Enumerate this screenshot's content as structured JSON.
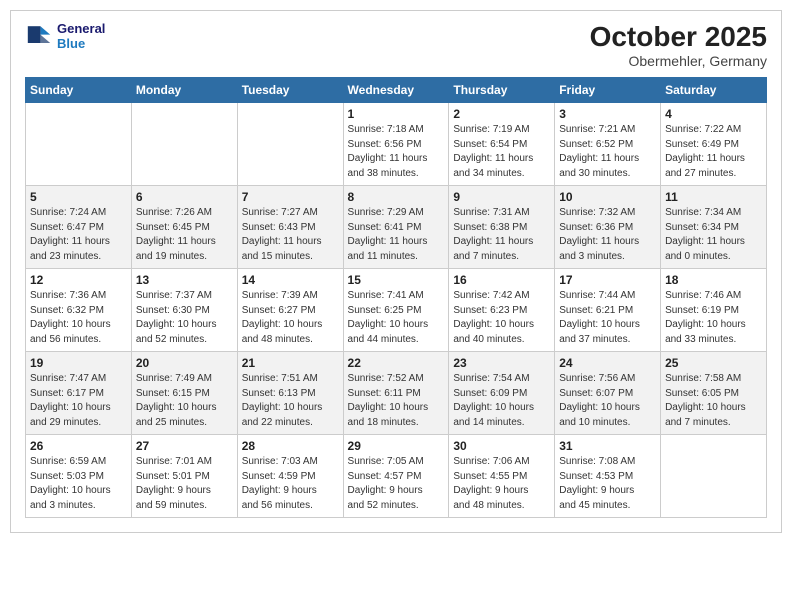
{
  "header": {
    "logo_line1": "General",
    "logo_line2": "Blue",
    "month": "October 2025",
    "location": "Obermehler, Germany"
  },
  "days_of_week": [
    "Sunday",
    "Monday",
    "Tuesday",
    "Wednesday",
    "Thursday",
    "Friday",
    "Saturday"
  ],
  "weeks": [
    [
      {
        "day": "",
        "info": ""
      },
      {
        "day": "",
        "info": ""
      },
      {
        "day": "",
        "info": ""
      },
      {
        "day": "1",
        "info": "Sunrise: 7:18 AM\nSunset: 6:56 PM\nDaylight: 11 hours\nand 38 minutes."
      },
      {
        "day": "2",
        "info": "Sunrise: 7:19 AM\nSunset: 6:54 PM\nDaylight: 11 hours\nand 34 minutes."
      },
      {
        "day": "3",
        "info": "Sunrise: 7:21 AM\nSunset: 6:52 PM\nDaylight: 11 hours\nand 30 minutes."
      },
      {
        "day": "4",
        "info": "Sunrise: 7:22 AM\nSunset: 6:49 PM\nDaylight: 11 hours\nand 27 minutes."
      }
    ],
    [
      {
        "day": "5",
        "info": "Sunrise: 7:24 AM\nSunset: 6:47 PM\nDaylight: 11 hours\nand 23 minutes."
      },
      {
        "day": "6",
        "info": "Sunrise: 7:26 AM\nSunset: 6:45 PM\nDaylight: 11 hours\nand 19 minutes."
      },
      {
        "day": "7",
        "info": "Sunrise: 7:27 AM\nSunset: 6:43 PM\nDaylight: 11 hours\nand 15 minutes."
      },
      {
        "day": "8",
        "info": "Sunrise: 7:29 AM\nSunset: 6:41 PM\nDaylight: 11 hours\nand 11 minutes."
      },
      {
        "day": "9",
        "info": "Sunrise: 7:31 AM\nSunset: 6:38 PM\nDaylight: 11 hours\nand 7 minutes."
      },
      {
        "day": "10",
        "info": "Sunrise: 7:32 AM\nSunset: 6:36 PM\nDaylight: 11 hours\nand 3 minutes."
      },
      {
        "day": "11",
        "info": "Sunrise: 7:34 AM\nSunset: 6:34 PM\nDaylight: 11 hours\nand 0 minutes."
      }
    ],
    [
      {
        "day": "12",
        "info": "Sunrise: 7:36 AM\nSunset: 6:32 PM\nDaylight: 10 hours\nand 56 minutes."
      },
      {
        "day": "13",
        "info": "Sunrise: 7:37 AM\nSunset: 6:30 PM\nDaylight: 10 hours\nand 52 minutes."
      },
      {
        "day": "14",
        "info": "Sunrise: 7:39 AM\nSunset: 6:27 PM\nDaylight: 10 hours\nand 48 minutes."
      },
      {
        "day": "15",
        "info": "Sunrise: 7:41 AM\nSunset: 6:25 PM\nDaylight: 10 hours\nand 44 minutes."
      },
      {
        "day": "16",
        "info": "Sunrise: 7:42 AM\nSunset: 6:23 PM\nDaylight: 10 hours\nand 40 minutes."
      },
      {
        "day": "17",
        "info": "Sunrise: 7:44 AM\nSunset: 6:21 PM\nDaylight: 10 hours\nand 37 minutes."
      },
      {
        "day": "18",
        "info": "Sunrise: 7:46 AM\nSunset: 6:19 PM\nDaylight: 10 hours\nand 33 minutes."
      }
    ],
    [
      {
        "day": "19",
        "info": "Sunrise: 7:47 AM\nSunset: 6:17 PM\nDaylight: 10 hours\nand 29 minutes."
      },
      {
        "day": "20",
        "info": "Sunrise: 7:49 AM\nSunset: 6:15 PM\nDaylight: 10 hours\nand 25 minutes."
      },
      {
        "day": "21",
        "info": "Sunrise: 7:51 AM\nSunset: 6:13 PM\nDaylight: 10 hours\nand 22 minutes."
      },
      {
        "day": "22",
        "info": "Sunrise: 7:52 AM\nSunset: 6:11 PM\nDaylight: 10 hours\nand 18 minutes."
      },
      {
        "day": "23",
        "info": "Sunrise: 7:54 AM\nSunset: 6:09 PM\nDaylight: 10 hours\nand 14 minutes."
      },
      {
        "day": "24",
        "info": "Sunrise: 7:56 AM\nSunset: 6:07 PM\nDaylight: 10 hours\nand 10 minutes."
      },
      {
        "day": "25",
        "info": "Sunrise: 7:58 AM\nSunset: 6:05 PM\nDaylight: 10 hours\nand 7 minutes."
      }
    ],
    [
      {
        "day": "26",
        "info": "Sunrise: 6:59 AM\nSunset: 5:03 PM\nDaylight: 10 hours\nand 3 minutes."
      },
      {
        "day": "27",
        "info": "Sunrise: 7:01 AM\nSunset: 5:01 PM\nDaylight: 9 hours\nand 59 minutes."
      },
      {
        "day": "28",
        "info": "Sunrise: 7:03 AM\nSunset: 4:59 PM\nDaylight: 9 hours\nand 56 minutes."
      },
      {
        "day": "29",
        "info": "Sunrise: 7:05 AM\nSunset: 4:57 PM\nDaylight: 9 hours\nand 52 minutes."
      },
      {
        "day": "30",
        "info": "Sunrise: 7:06 AM\nSunset: 4:55 PM\nDaylight: 9 hours\nand 48 minutes."
      },
      {
        "day": "31",
        "info": "Sunrise: 7:08 AM\nSunset: 4:53 PM\nDaylight: 9 hours\nand 45 minutes."
      },
      {
        "day": "",
        "info": ""
      }
    ]
  ]
}
